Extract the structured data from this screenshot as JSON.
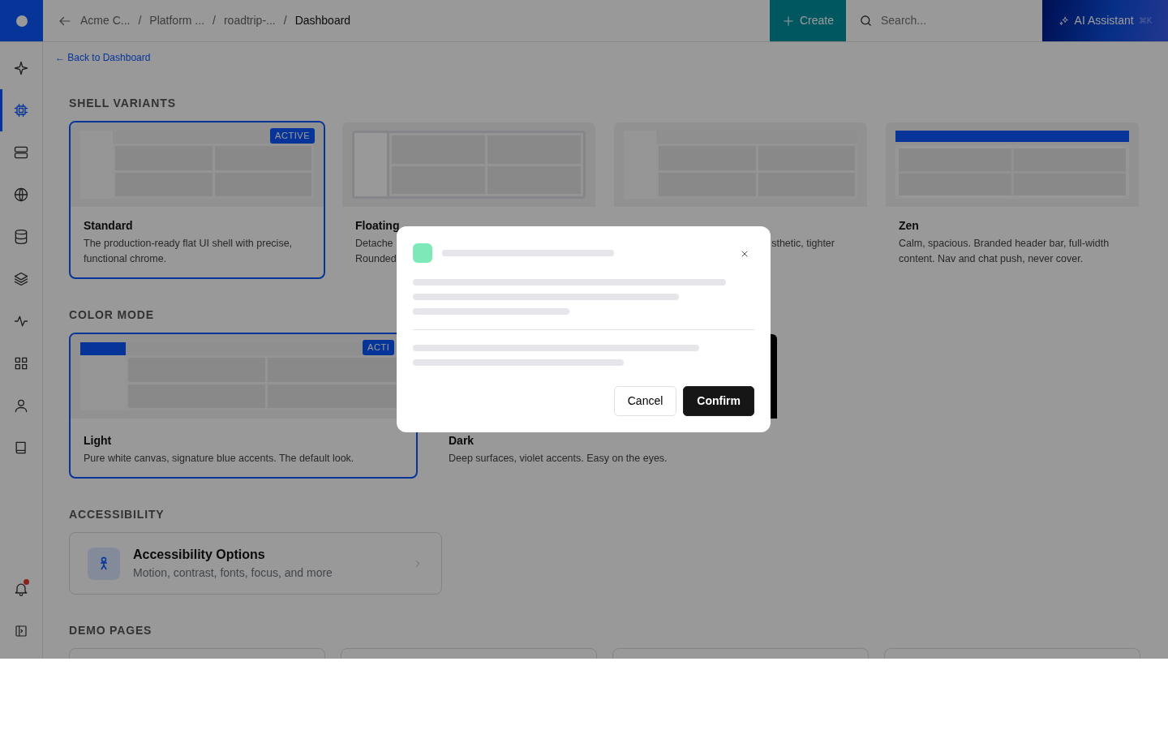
{
  "topbar": {
    "breadcrumbs": [
      {
        "label": "Acme C...",
        "current": false
      },
      {
        "separator": "/",
        "label": "Platform ...",
        "current": false
      },
      {
        "separator": "/",
        "label": "roadtrip-...",
        "current": false
      },
      {
        "separator": "/",
        "label": "Dashboard",
        "current": true
      }
    ],
    "create_button": "Create",
    "search": {
      "placeholder": "Search..."
    },
    "assistant_button": {
      "label": "AI Assistant",
      "shortcut": "⌘K"
    }
  },
  "sidebar": {
    "items": [
      {
        "selected": false
      },
      {
        "selected": true
      },
      {
        "selected": false
      },
      {
        "selected": false
      },
      {
        "selected": false
      },
      {
        "selected": false
      },
      {
        "selected": false
      },
      {
        "selected": false
      },
      {
        "selected": false
      },
      {
        "selected": false
      }
    ],
    "notifications": {
      "unread": true
    }
  },
  "back_link": "← Back to Dashboard",
  "shell_variants": {
    "heading": "SHELL VARIANTS",
    "cards": [
      {
        "kind": "standard",
        "title": "Standard",
        "desc_lines": [
          "The production-ready flat UI shell with precise,",
          "functional chrome."
        ],
        "selected": true,
        "badge": "ACTIVE"
      },
      {
        "kind": "floating",
        "title": "Floating",
        "desc_lines": [
          "Detache",
          "Rounded"
        ],
        "selected": false
      },
      {
        "kind": "compact",
        "desc_lines": [
          "sthetic, tighter"
        ],
        "selected": false
      },
      {
        "kind": "zen",
        "title": "Zen",
        "desc_lines": [
          "Calm, spacious. Branded header bar, full-width",
          "content. Nav and chat push, never cover."
        ],
        "selected": false
      }
    ]
  },
  "color_mode": {
    "heading": "COLOR MODE",
    "cards": [
      {
        "kind": "light",
        "title": "Light",
        "desc_lines": [
          "Pure white canvas, signature blue accents. The default look."
        ],
        "selected": true,
        "badge": "ACTI"
      },
      {
        "kind": "dark",
        "title": "Dark",
        "desc_lines": [
          "Deep surfaces, violet accents. Easy on the eyes."
        ],
        "selected": false
      }
    ]
  },
  "accessibility": {
    "heading": "ACCESSIBILITY",
    "title": "Accessibility Options",
    "subtitle": "Motion, contrast, fonts, focus, and more"
  },
  "demo_pages": {
    "heading": "DEMO PAGES"
  },
  "modal": {
    "cancel": "Cancel",
    "confirm": "Confirm"
  }
}
